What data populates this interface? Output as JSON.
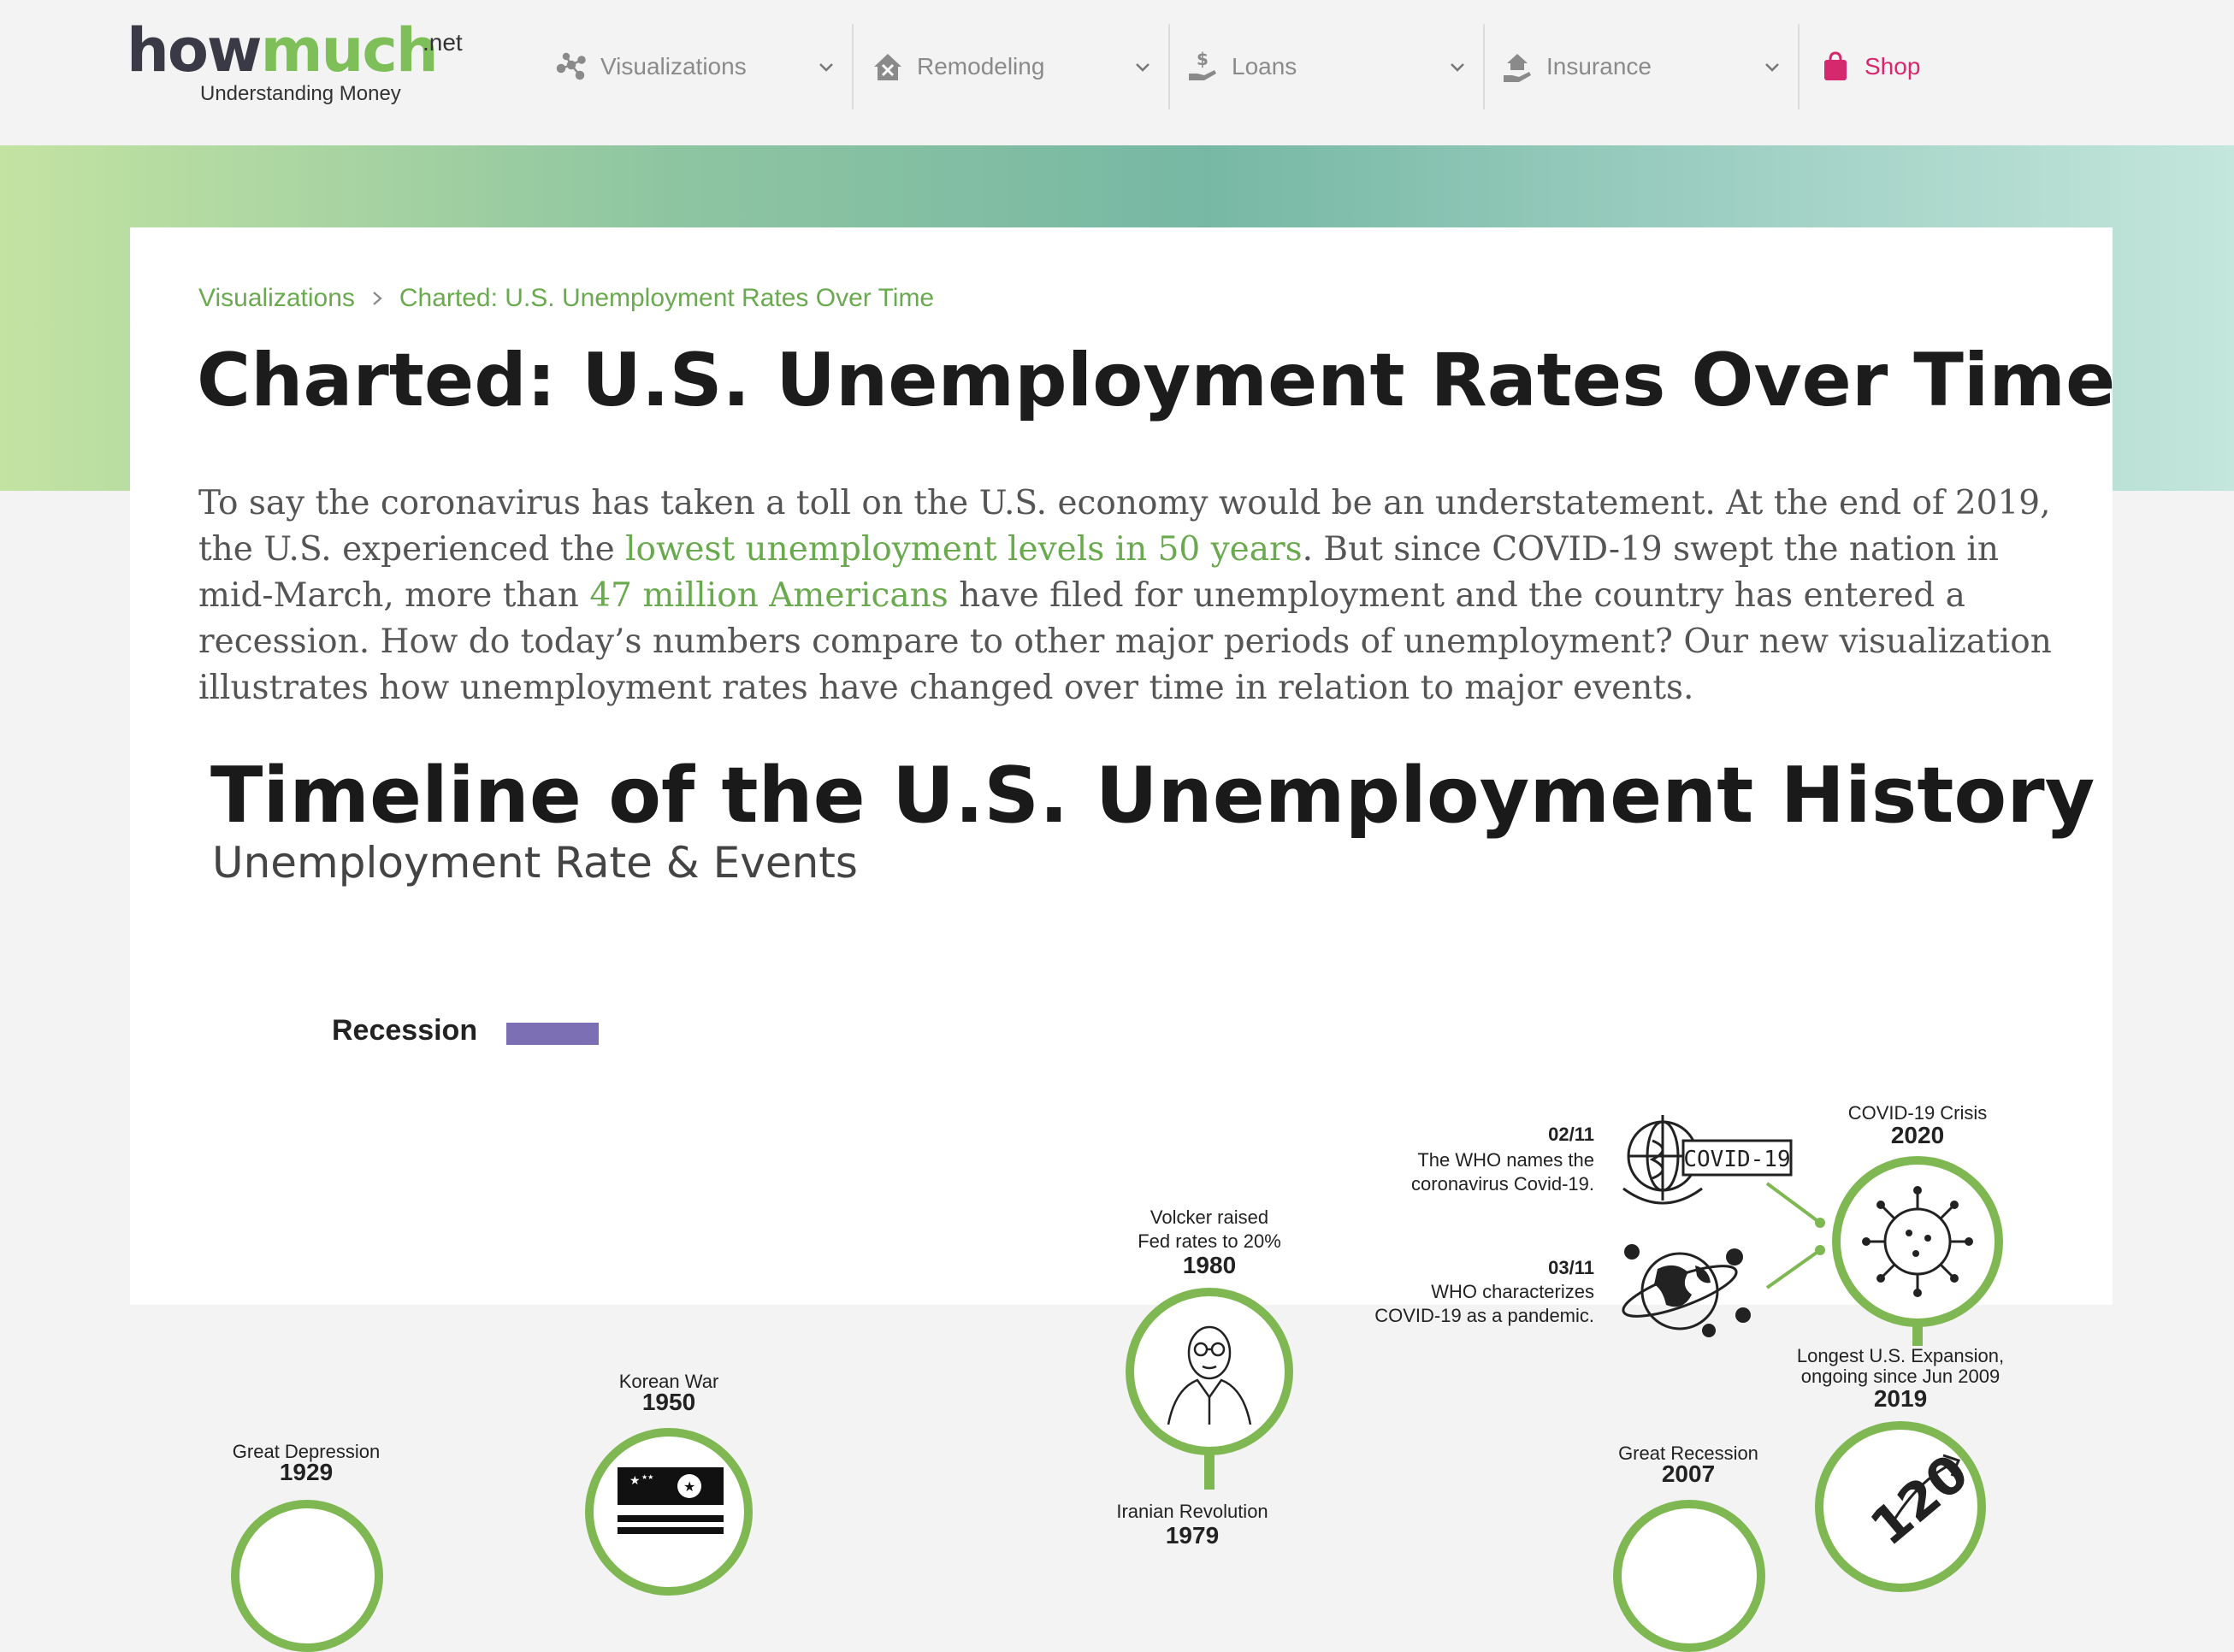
{
  "logo": {
    "how": "how",
    "much": "much",
    "net": ".net",
    "tagline": "Understanding Money"
  },
  "nav": {
    "items": [
      {
        "label": "Visualizations",
        "icon": "network-icon"
      },
      {
        "label": "Remodeling",
        "icon": "house-tools-icon"
      },
      {
        "label": "Loans",
        "icon": "hand-dollar-icon"
      },
      {
        "label": "Insurance",
        "icon": "house-hand-icon"
      }
    ],
    "shop": {
      "label": "Shop",
      "icon": "shopping-bag-icon"
    }
  },
  "colors": {
    "accent": "#6aaa4f",
    "shop": "#d6286c",
    "recession": "#7d6fb3",
    "circle": "#7fb852"
  },
  "breadcrumb": {
    "parent": "Visualizations",
    "current": "Charted: U.S. Unemployment Rates Over Time"
  },
  "page_title": "Charted: U.S. Unemployment Rates Over Time",
  "intro": {
    "part1": "To say the coronavirus has taken a toll on the U.S. economy would be an understatement. At the end of 2019, the U.S. experienced the ",
    "link1": "lowest unemployment levels in 50 years",
    "part2": ". But since COVID-19 swept the nation in mid-March, more than ",
    "link2": "47 million Americans",
    "part3": " have filed for unemployment and the country has entered a recession. How do today’s numbers compare to other major periods of unemployment? Our new visualization illustrates how unemployment rates have changed over time in relation to major events."
  },
  "infographic": {
    "title": "Timeline of the U.S. Unemployment History",
    "subtitle": "Unemployment Rate & Events",
    "legend_label": "Recession",
    "events": {
      "depression": {
        "label": "Great Depression",
        "year": "1929"
      },
      "korea": {
        "label": "Korean War",
        "year": "1950"
      },
      "volcker": {
        "label1": "Volcker raised",
        "label2": "Fed rates to 20%",
        "year": "1980"
      },
      "iran": {
        "label": "Iranian Revolution",
        "year": "1979"
      },
      "great_recession": {
        "label": "Great Recession",
        "year": "2007"
      },
      "expansion": {
        "label1": "Longest U.S. Expansion,",
        "label2": "ongoing since Jun 2009",
        "year": "2019"
      },
      "covid": {
        "label": "COVID-19 Crisis",
        "year": "2020"
      },
      "who_names": {
        "date": "02/11",
        "line1": "The WHO names the",
        "line2": "coronavirus Covid-19."
      },
      "who_pandemic": {
        "date": "03/11",
        "line1": "WHO characterizes",
        "line2": "COVID-19 as a pandemic."
      },
      "covid_badge": "COVID-19",
      "expansion_badge": "120"
    }
  }
}
